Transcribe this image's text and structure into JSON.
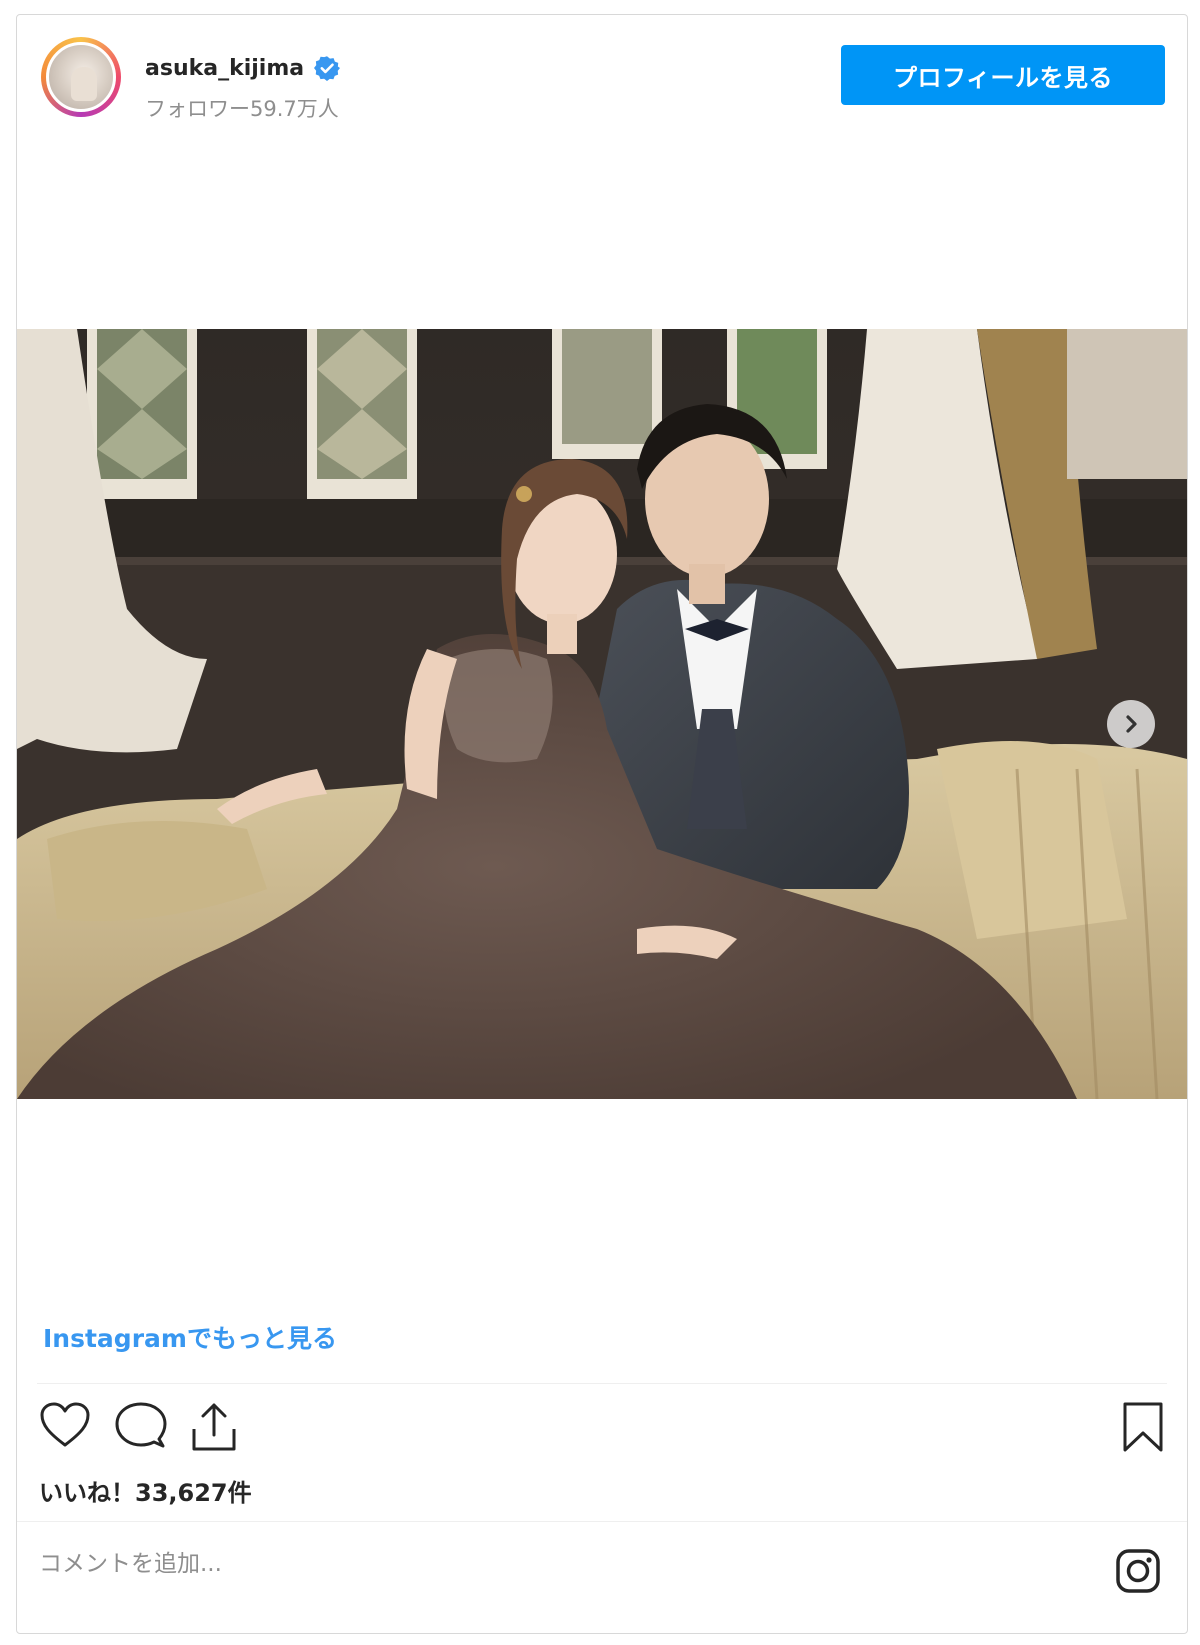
{
  "header": {
    "username": "asuka_kijima",
    "followers": "フォロワー59.7万人",
    "profile_button": "プロフィールを見る"
  },
  "post": {
    "more_link": "Instagramでもっと見る",
    "likes": "いいね！33,627件",
    "comment_placeholder": "コメントを追加..."
  },
  "icons": {
    "verified": "verified-badge-icon",
    "next": "chevron-right-icon",
    "like": "heart-icon",
    "comment": "comment-bubble-icon",
    "share": "share-icon",
    "save": "bookmark-icon",
    "instagram": "instagram-logo-icon"
  },
  "colors": {
    "accent": "#0095f6",
    "link": "#3897f0",
    "text": "#262626",
    "muted": "#8e8e8e"
  }
}
